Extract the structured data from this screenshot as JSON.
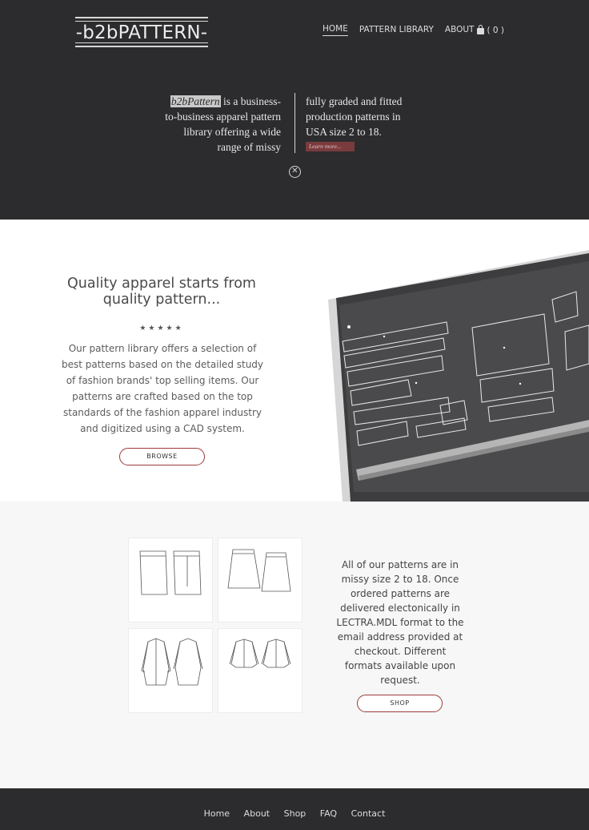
{
  "header": {
    "logo": "-b2bPATTERN-",
    "nav": [
      "HOME",
      "PATTERN LIBRARY",
      "ABOUT"
    ],
    "cart_count": "( 0 )"
  },
  "intro": {
    "brand": "b2bPattern",
    "left_rest": " is a business-to-business apparel pattern library offering a wide range of missy",
    "right": "fully graded and fitted production patterns in USA size 2 to 18.",
    "learn_more": "Learn more..."
  },
  "quality": {
    "title": "Quality apparel starts from quality pattern...",
    "stars": "★★★★★",
    "body": "Our pattern library offers a selection of best patterns based on the detailed study of fashion brands' top selling items. Our patterns are crafted based on the top standards of the fashion apparel industry and digitized using a CAD system.",
    "button": "BROWSE"
  },
  "patterns": {
    "body": "All of our patterns are in missy size 2 to 18. Once ordered patterns are delivered electonically in LECTRA.MDL format to the email address provided at checkout. Different formats available upon request.",
    "button": "SHOP"
  },
  "footer": {
    "links": [
      "Home",
      "About",
      "Shop",
      "FAQ",
      "Contact"
    ]
  }
}
